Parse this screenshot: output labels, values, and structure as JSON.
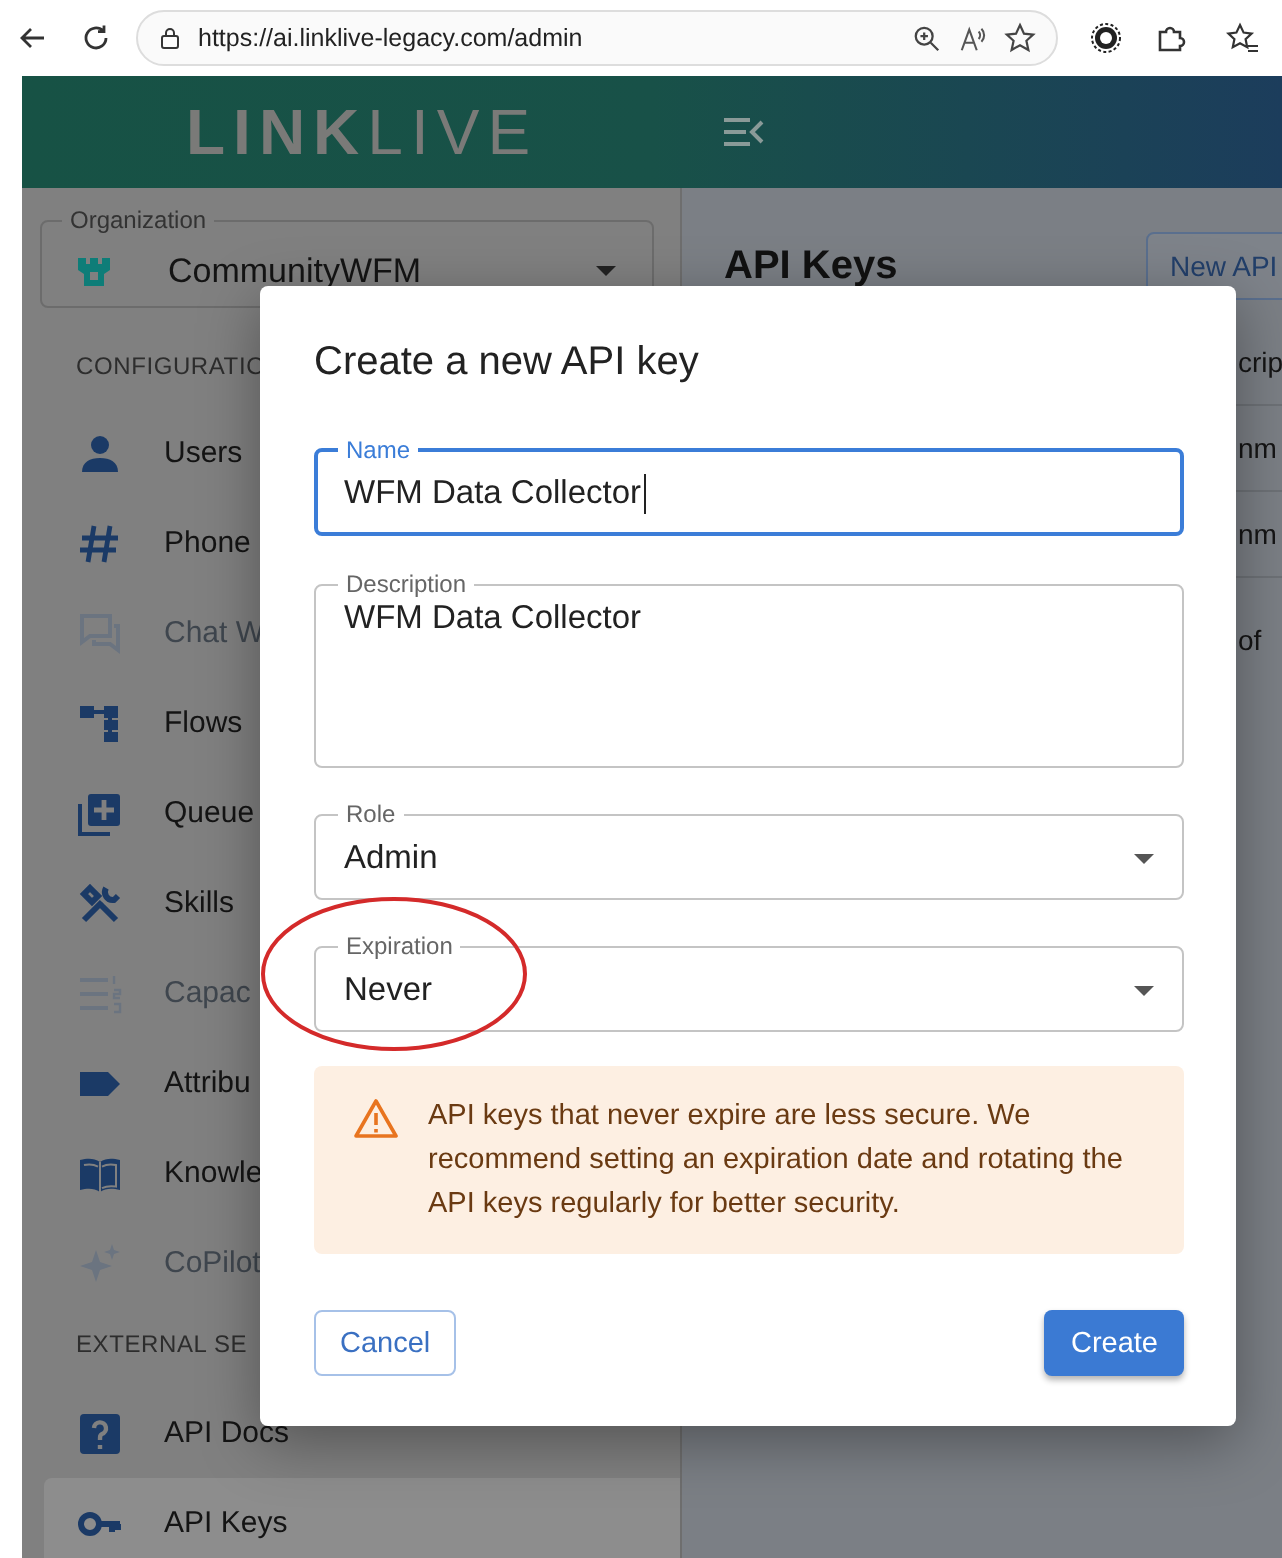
{
  "browser": {
    "url": "https://ai.linklive-legacy.com/admin"
  },
  "header": {
    "logo": "**LINK**LIVE"
  },
  "sidebar": {
    "organization": {
      "label": "Organization",
      "value": "CommunityWFM"
    },
    "sections": [
      {
        "title": "CONFIGURATIO",
        "items": [
          {
            "label": "Users",
            "disabled": false,
            "selected": false
          },
          {
            "label": "Phone",
            "disabled": false,
            "selected": false
          },
          {
            "label": "Chat W",
            "disabled": true,
            "selected": false
          },
          {
            "label": "Flows",
            "disabled": false,
            "selected": false
          },
          {
            "label": "Queue",
            "disabled": false,
            "selected": false
          },
          {
            "label": "Skills",
            "disabled": false,
            "selected": false
          },
          {
            "label": "Capac",
            "disabled": true,
            "selected": false
          },
          {
            "label": "Attribu",
            "disabled": false,
            "selected": false
          },
          {
            "label": "Knowle",
            "disabled": false,
            "selected": false
          },
          {
            "label": "CoPilot",
            "disabled": true,
            "selected": false
          }
        ]
      },
      {
        "title": "EXTERNAL SE",
        "items": [
          {
            "label": "API Docs",
            "disabled": false,
            "selected": false
          },
          {
            "label": "API Keys",
            "disabled": false,
            "selected": true
          }
        ]
      }
    ]
  },
  "main": {
    "title": "API Keys",
    "new_button": "New API",
    "table_cells": [
      "crip",
      "nm",
      "nm",
      "of"
    ]
  },
  "dialog": {
    "title": "Create a new API key",
    "fields": [
      {
        "kind": "text",
        "label": "Name",
        "value": "WFM Data Collector",
        "focused": true,
        "circled": false
      },
      {
        "kind": "textarea",
        "label": "Description",
        "value": "WFM Data Collector",
        "focused": false,
        "circled": false
      },
      {
        "kind": "select",
        "label": "Role",
        "value": "Admin",
        "focused": false,
        "circled": false
      },
      {
        "kind": "select",
        "label": "Expiration",
        "value": "Never",
        "focused": false,
        "circled": true
      }
    ],
    "warning": "API keys that never expire are less secure. We recommend setting an expiration date and rotating the API keys regularly for better security.",
    "buttons": [
      {
        "label": "Cancel",
        "kind": "outlined"
      },
      {
        "label": "Create",
        "kind": "filled"
      }
    ]
  }
}
